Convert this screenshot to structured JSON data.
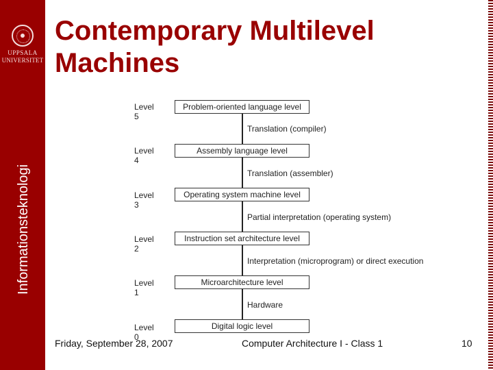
{
  "sidebar": {
    "logo_line1": "UPPSALA",
    "logo_line2": "UNIVERSITET",
    "department": "Informationsteknologi",
    "color": "#990000"
  },
  "slide": {
    "title_line1": "Contemporary Multilevel",
    "title_line2": "Machines",
    "title_color": "#990000"
  },
  "diagram": {
    "levels": [
      {
        "label": "Level 5",
        "box": "Problem-oriented language level"
      },
      {
        "label": "Level 4",
        "box": "Assembly language level"
      },
      {
        "label": "Level 3",
        "box": "Operating system machine level"
      },
      {
        "label": "Level 2",
        "box": "Instruction set architecture level"
      },
      {
        "label": "Level 1",
        "box": "Microarchitecture level"
      },
      {
        "label": "Level 0",
        "box": "Digital logic level"
      }
    ],
    "transitions": [
      "Translation (compiler)",
      "Translation (assembler)",
      "Partial interpretation (operating system)",
      "Interpretation (microprogram) or direct execution",
      "Hardware"
    ]
  },
  "footer": {
    "date": "Friday, September 28, 2007",
    "course": "Computer Architecture I - Class 1",
    "page": "10"
  }
}
